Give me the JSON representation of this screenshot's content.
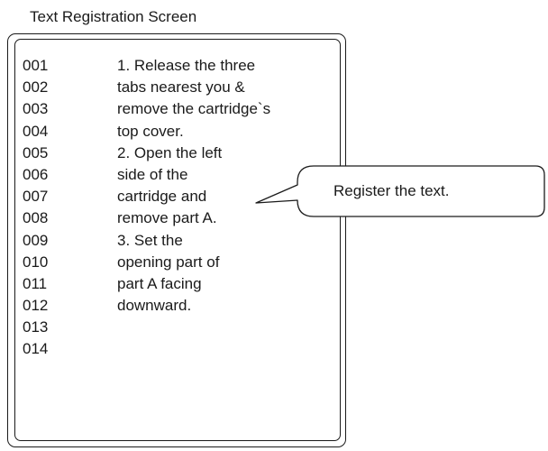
{
  "screen": {
    "title": "Text Registration Screen"
  },
  "rows": [
    {
      "num": "001",
      "text": "1. Release the three"
    },
    {
      "num": "002",
      "text": "tabs nearest you &"
    },
    {
      "num": "003",
      "text": "remove the cartridge`s"
    },
    {
      "num": "004",
      "text": "top cover."
    },
    {
      "num": "005",
      "text": "2. Open the left"
    },
    {
      "num": "006",
      "text": "side of the"
    },
    {
      "num": "007",
      "text": "cartridge and"
    },
    {
      "num": "008",
      "text": "remove part A."
    },
    {
      "num": "009",
      "text": "3. Set the"
    },
    {
      "num": "010",
      "text": "opening part of"
    },
    {
      "num": "011",
      "text": "part A facing"
    },
    {
      "num": "012",
      "text": "downward."
    },
    {
      "num": "013",
      "text": ""
    },
    {
      "num": "014",
      "text": ""
    }
  ],
  "callout": {
    "text": "Register the text."
  }
}
